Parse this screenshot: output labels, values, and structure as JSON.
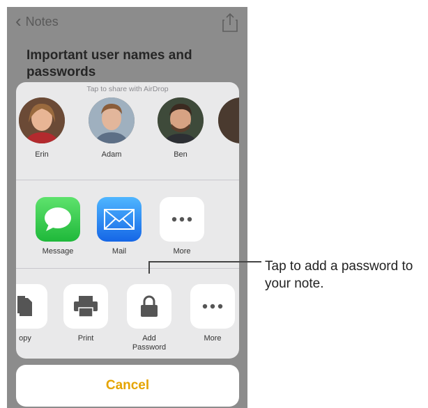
{
  "nav": {
    "back_label": "Notes"
  },
  "note": {
    "title": "Important user names and passwords"
  },
  "share_sheet": {
    "airdrop_hint": "Tap to share with AirDrop",
    "contacts": [
      {
        "name": "Erin"
      },
      {
        "name": "Adam"
      },
      {
        "name": "Ben"
      }
    ],
    "apps": [
      {
        "label": "Message",
        "icon": "message-icon",
        "color": "#2fc84a"
      },
      {
        "label": "Mail",
        "icon": "mail-icon",
        "color": "#1d7ff0"
      },
      {
        "label": "More",
        "icon": "more-icon"
      }
    ],
    "actions": [
      {
        "label": "opy",
        "icon": "copy-icon"
      },
      {
        "label": "Print",
        "icon": "print-icon"
      },
      {
        "label": "Add Password",
        "icon": "lock-icon"
      },
      {
        "label": "More",
        "icon": "more-icon"
      }
    ],
    "cancel_label": "Cancel"
  },
  "callout": {
    "text": "Tap to add a password to your note."
  },
  "colors": {
    "accent": "#e5a400",
    "dim_background": "#8c8c8c",
    "sheet": "#e9e9ea"
  }
}
